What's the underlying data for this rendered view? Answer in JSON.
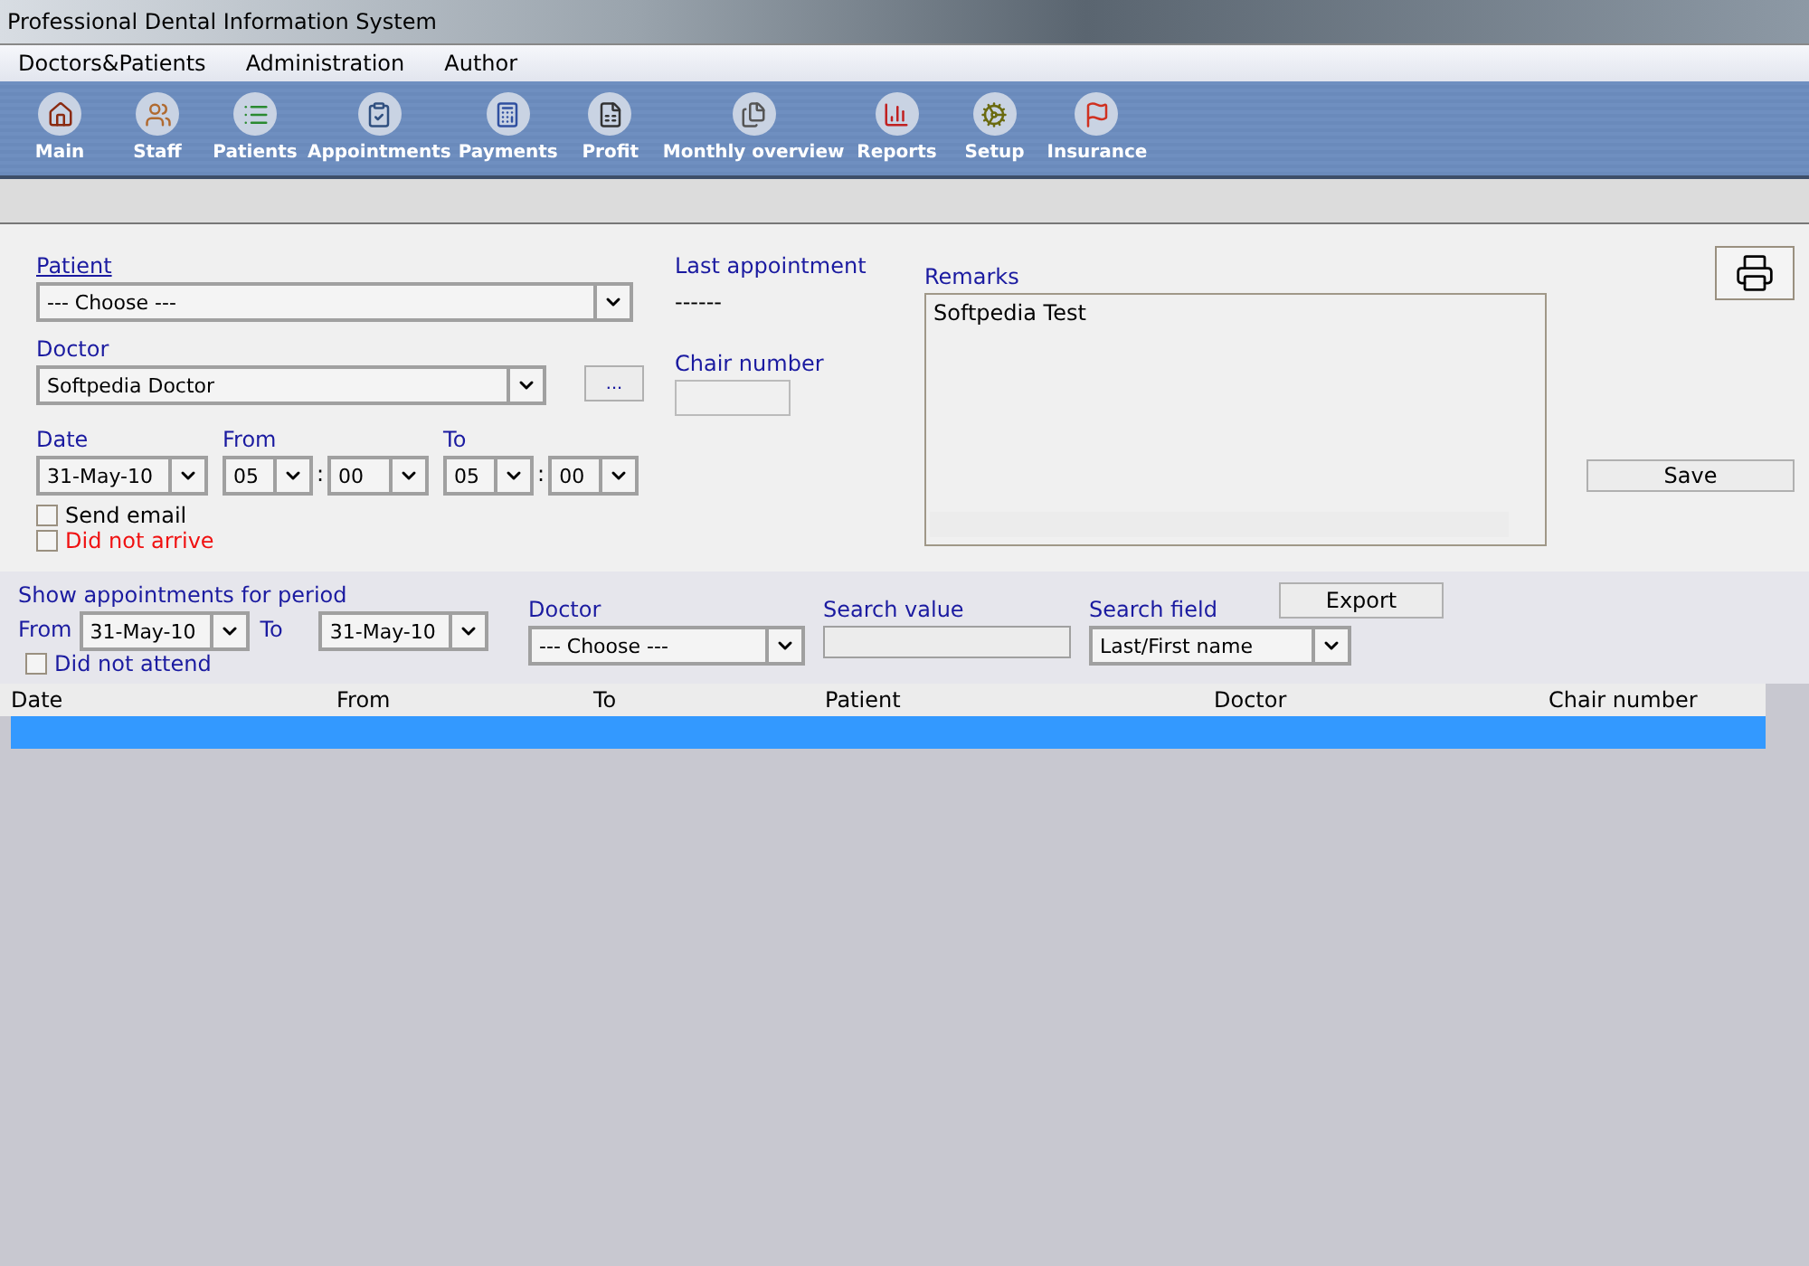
{
  "window": {
    "title": "Professional Dental Information System"
  },
  "menu": [
    "Doctors&Patients",
    "Administration",
    "Author"
  ],
  "toolbar": [
    {
      "label": "Main"
    },
    {
      "label": "Staff"
    },
    {
      "label": "Patients"
    },
    {
      "label": "Appointments"
    },
    {
      "label": "Payments"
    },
    {
      "label": "Profit"
    },
    {
      "label": "Monthly overview"
    },
    {
      "label": "Reports"
    },
    {
      "label": "Setup"
    },
    {
      "label": "Insurance"
    }
  ],
  "form": {
    "patient": {
      "label": "Patient",
      "value": "--- Choose ---"
    },
    "doctor": {
      "label": "Doctor",
      "value": "Softpedia Doctor",
      "more": "..."
    },
    "date": {
      "label": "Date",
      "value": "31-May-10"
    },
    "from": {
      "label": "From",
      "hour": "05",
      "separator": ":",
      "minute": "00"
    },
    "to": {
      "label": "To",
      "hour": "05",
      "separator": ":",
      "minute": "00"
    },
    "send_email": {
      "label": "Send email",
      "checked": false
    },
    "did_not_arrive": {
      "label": "Did not arrive",
      "checked": false
    },
    "last_appointment": {
      "label": "Last appointment",
      "value": "------"
    },
    "chair_number": {
      "label": "Chair number"
    },
    "remarks": {
      "label": "Remarks",
      "value": "Softpedia Test"
    },
    "save": "Save"
  },
  "filter": {
    "title": "Show appointments for period",
    "from_label": "From",
    "from_value": "31-May-10",
    "to_label": "To",
    "to_value": "31-May-10",
    "did_not_attend": {
      "label": "Did not attend",
      "checked": false
    },
    "doctor": {
      "label": "Doctor",
      "value": "--- Choose ---"
    },
    "search_value": {
      "label": "Search value"
    },
    "search_field": {
      "label": "Search field",
      "value": "Last/First name"
    },
    "export": "Export"
  },
  "table": {
    "columns": [
      "Date",
      "From",
      "To",
      "Patient",
      "Doctor",
      "Chair number"
    ],
    "rows": [
      {
        "selected": true
      }
    ]
  }
}
